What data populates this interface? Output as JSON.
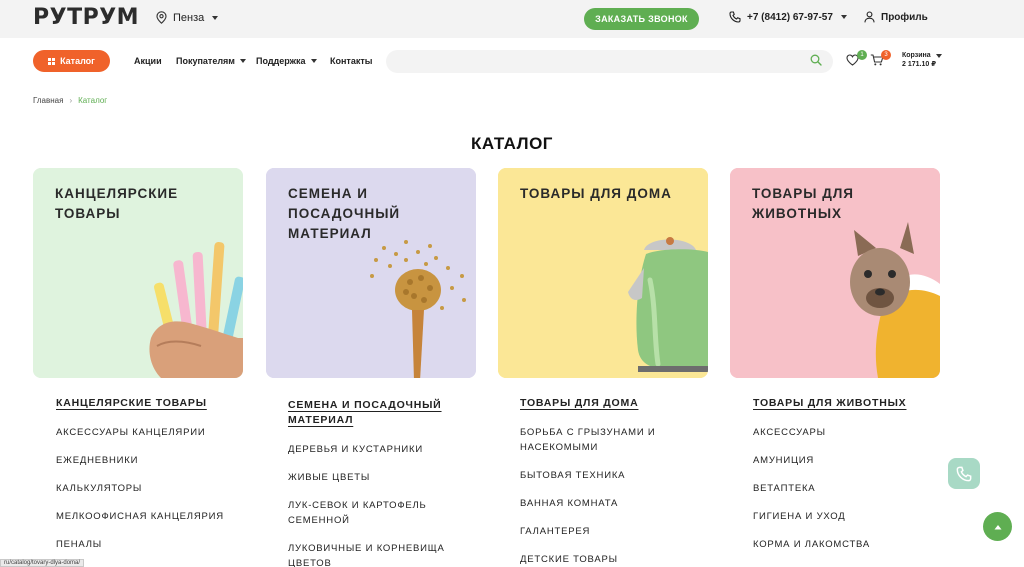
{
  "header": {
    "logo_text": "РУТРУМ",
    "city": "Пенза",
    "callback_label": "ЗАКАЗАТЬ ЗВОНОК",
    "phone": "+7 (8412) 67-97-57",
    "profile_label": "Профиль"
  },
  "nav": {
    "catalog_label": "Каталог",
    "links": [
      "Акции",
      "Покупателям",
      "Поддержка",
      "Контакты"
    ],
    "search_placeholder": "",
    "favorites_count": "1",
    "cart_count": "3",
    "cart_label": "Корзина",
    "cart_total": "2 171.10 ₽"
  },
  "breadcrumb": [
    "Главная",
    "Каталог"
  ],
  "page_title": "КАТАЛОГ",
  "categories": [
    {
      "card_title": "КАНЦЕЛЯРСКИЕ ТОВАРЫ",
      "bg": "#dff3de",
      "heading": "КАНЦЕЛЯРСКИЕ ТОВАРЫ",
      "items": [
        "АКСЕССУАРЫ КАНЦЕЛЯРИИ",
        "ЕЖЕДНЕВНИКИ",
        "КАЛЬКУЛЯТОРЫ",
        "МЕЛКООФИСНАЯ КАНЦЕЛЯРИЯ",
        "ПЕНАЛЫ"
      ]
    },
    {
      "card_title": "СЕМЕНА И ПОСАДОЧНЫЙ МАТЕРИАЛ",
      "bg": "#dcd9ee",
      "heading": "СЕМЕНА И ПОСАДОЧНЫЙ МАТЕРИАЛ",
      "items": [
        "ДЕРЕВЬЯ И КУСТАРНИКИ",
        "ЖИВЫЕ ЦВЕТЫ",
        "ЛУК-СЕВОК И КАРТОФЕЛЬ СЕМЕННОЙ",
        "ЛУКОВИЧНЫЕ И КОРНЕВИЩА ЦВЕТОВ"
      ]
    },
    {
      "card_title": "ТОВАРЫ ДЛЯ ДОМА",
      "bg": "#fbe796",
      "heading": "ТОВАРЫ ДЛЯ ДОМА",
      "items": [
        "БОРЬБА С ГРЫЗУНАМИ И НАСЕКОМЫМИ",
        "БЫТОВАЯ ТЕХНИКА",
        "ВАННАЯ КОМНАТА",
        "ГАЛАНТЕРЕЯ",
        "ДЕТСКИЕ ТОВАРЫ"
      ]
    },
    {
      "card_title": "ТОВАРЫ ДЛЯ ЖИВОТНЫХ",
      "bg": "#f7c1c8",
      "heading": "ТОВАРЫ ДЛЯ ЖИВОТНЫХ",
      "items": [
        "АКСЕССУАРЫ",
        "АМУНИЦИЯ",
        "ВЕТАПТЕКА",
        "ГИГИЕНА И УХОД",
        "КОРМА И ЛАКОМСТВА"
      ]
    }
  ],
  "status_url": "ru/catalog/tovary-dlya-doma/",
  "colors": {
    "accent_green": "#5fae52",
    "accent_orange": "#f0622a"
  },
  "icons": [
    "location-pin-icon",
    "phone-icon",
    "user-icon",
    "grid-icon",
    "search-icon",
    "heart-icon",
    "cart-icon",
    "phone-float-icon",
    "arrow-up-icon"
  ]
}
